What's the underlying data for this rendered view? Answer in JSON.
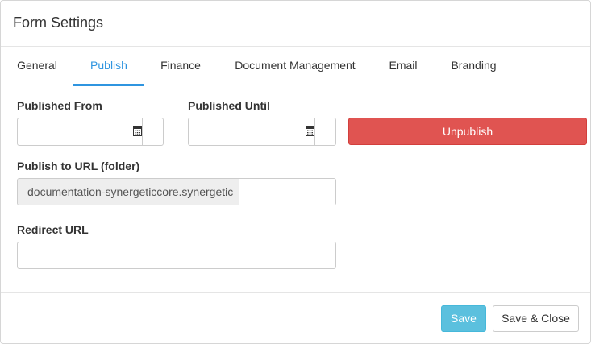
{
  "dialog": {
    "title": "Form Settings"
  },
  "tabs": [
    {
      "label": "General",
      "active": false
    },
    {
      "label": "Publish",
      "active": true
    },
    {
      "label": "Finance",
      "active": false
    },
    {
      "label": "Document Management",
      "active": false
    },
    {
      "label": "Email",
      "active": false
    },
    {
      "label": "Branding",
      "active": false
    }
  ],
  "publish": {
    "published_from_label": "Published From",
    "published_from_value": "",
    "published_until_label": "Published Until",
    "published_until_value": "",
    "unpublish_label": "Unpublish",
    "url_label": "Publish to URL (folder)",
    "url_prefix": "documentation-synergeticcore.synergetic",
    "url_folder_value": "",
    "redirect_label": "Redirect URL",
    "redirect_value": "",
    "calendar_icon": "calendar-icon"
  },
  "footer": {
    "save_label": "Save",
    "save_close_label": "Save & Close"
  },
  "colors": {
    "accent": "#2f95e0",
    "danger": "#e05451",
    "save": "#5bc0de"
  }
}
